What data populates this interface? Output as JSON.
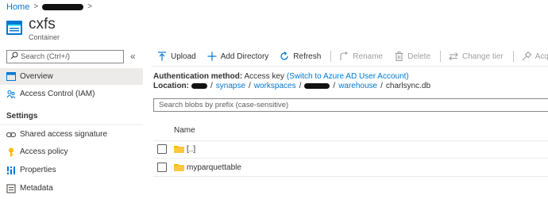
{
  "breadcrumb": {
    "home": "Home",
    "separator": ">"
  },
  "header": {
    "title": "cxfs",
    "subtitle": "Container"
  },
  "sidebar": {
    "search_placeholder": "Search (Ctrl+/)",
    "collapse_glyph": "«",
    "items": [
      {
        "label": "Overview",
        "icon": "overview-icon",
        "selected": true
      },
      {
        "label": "Access Control (IAM)",
        "icon": "people-icon",
        "selected": false
      }
    ],
    "settings_heading": "Settings",
    "settings_items": [
      {
        "label": "Shared access signature",
        "icon": "link-icon"
      },
      {
        "label": "Access policy",
        "icon": "key-icon"
      },
      {
        "label": "Properties",
        "icon": "properties-icon"
      },
      {
        "label": "Metadata",
        "icon": "metadata-icon"
      }
    ]
  },
  "toolbar": {
    "upload": "Upload",
    "add_directory": "Add Directory",
    "refresh": "Refresh",
    "rename": "Rename",
    "delete": "Delete",
    "change_tier": "Change tier",
    "acquire": "Acquire l"
  },
  "auth": {
    "label": "Authentication method:",
    "value": "Access key",
    "link": "(Switch to Azure AD User Account)"
  },
  "location": {
    "label": "Location:",
    "segments": [
      "synapse",
      "workspaces",
      "warehouse"
    ],
    "current": "charlsync.db",
    "separator": "/"
  },
  "blob_search": {
    "placeholder": "Search blobs by prefix (case-sensitive)"
  },
  "table": {
    "name_header": "Name",
    "rows": [
      {
        "name": "[..]"
      },
      {
        "name": "myparquettable"
      }
    ]
  },
  "colors": {
    "accent": "#0078d4",
    "folder": "#ffb900",
    "disabled": "#a19f9d"
  }
}
